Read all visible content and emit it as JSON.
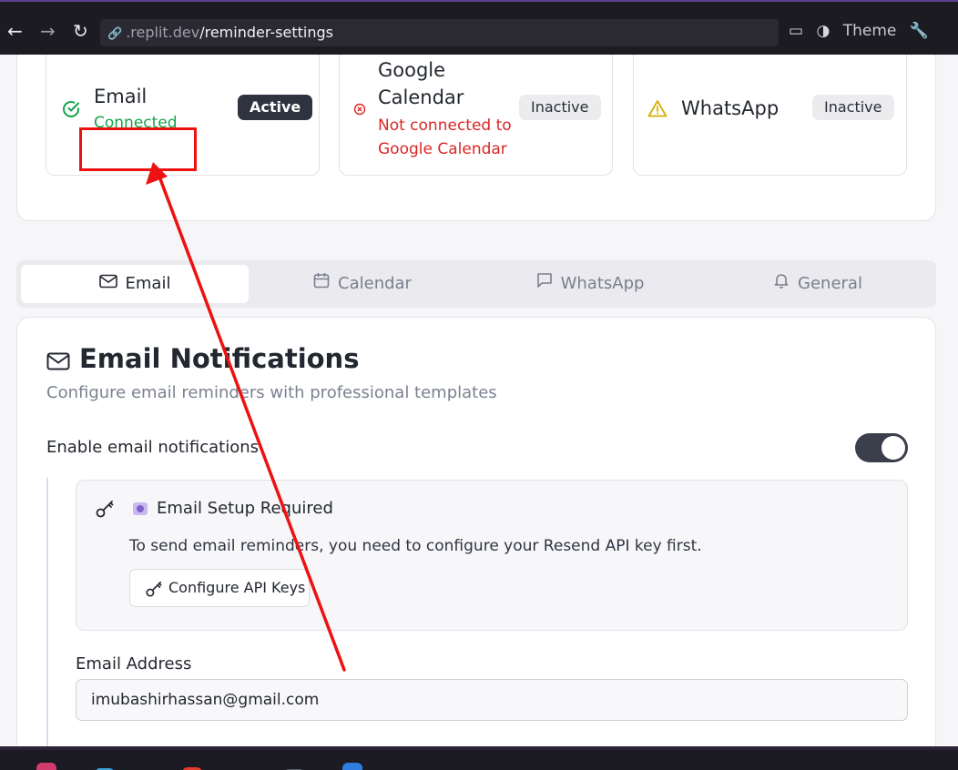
{
  "browser": {
    "url_host": ".replit.dev",
    "url_path": "/reminder-settings",
    "theme_label": "Theme"
  },
  "status_cards": [
    {
      "name": "Email",
      "subtitle": "Connected",
      "badge": "Active",
      "icon": "check-circle-icon",
      "subtitle_color": "#16a34a"
    },
    {
      "name_line1": "Google",
      "name_line2": "Calendar",
      "subtitle_line1": "Not connected to",
      "subtitle_line2": "Google Calendar",
      "badge": "Inactive",
      "icon": "x-circle-icon",
      "subtitle_color": "#dc2626"
    },
    {
      "name": "WhatsApp",
      "badge": "Inactive",
      "icon": "warning-triangle-icon"
    }
  ],
  "tabs": [
    {
      "label": "Email",
      "icon": "mail-icon",
      "selected": true
    },
    {
      "label": "Calendar",
      "icon": "calendar-icon",
      "selected": false
    },
    {
      "label": "WhatsApp",
      "icon": "chat-icon",
      "selected": false
    },
    {
      "label": "General",
      "icon": "bell-icon",
      "selected": false
    }
  ],
  "email_section": {
    "title": "Email Notifications",
    "subtitle": "Configure email reminders with professional templates",
    "enable_label": "Enable email notifications",
    "enabled": true,
    "setup": {
      "title": "Email Setup Required",
      "description": "To send email reminders, you need to configure your Resend API key first.",
      "button_label": "Configure API Keys"
    },
    "email_address_label": "Email Address",
    "email_address_value": "imubashirhassan@gmail.com"
  }
}
